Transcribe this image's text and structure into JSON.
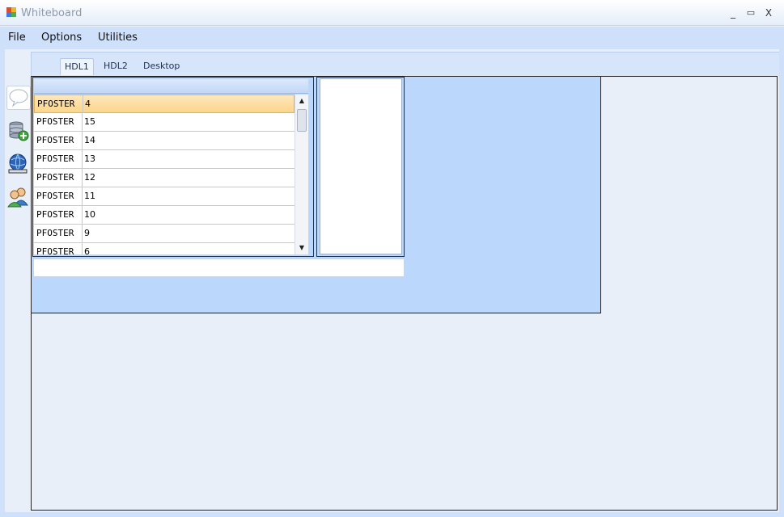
{
  "window": {
    "title": "Whiteboard",
    "minimize": "_",
    "maximize": "▭",
    "close": "X"
  },
  "menu": [
    "File",
    "Options",
    "Utilities"
  ],
  "tabs": [
    {
      "label": "HDL1",
      "active": true
    },
    {
      "label": "HDL2",
      "active": false
    },
    {
      "label": "Desktop",
      "active": false
    }
  ],
  "toolbar": [
    {
      "icon": "speech-bubble-icon",
      "active": true
    },
    {
      "icon": "database-add-icon",
      "active": false
    },
    {
      "icon": "globe-network-icon",
      "active": false
    },
    {
      "icon": "users-icon",
      "active": false
    }
  ],
  "grid": {
    "rows": [
      {
        "user": "PFOSTER",
        "value": "4",
        "selected": true
      },
      {
        "user": "PFOSTER",
        "value": "15"
      },
      {
        "user": "PFOSTER",
        "value": "14"
      },
      {
        "user": "PFOSTER",
        "value": "13"
      },
      {
        "user": "PFOSTER",
        "value": "12"
      },
      {
        "user": "PFOSTER",
        "value": "11"
      },
      {
        "user": "PFOSTER",
        "value": "10"
      },
      {
        "user": "PFOSTER",
        "value": "9"
      },
      {
        "user": "PFOSTER",
        "value": "6"
      }
    ]
  },
  "input": {
    "value": ""
  },
  "colors": {
    "panel": "#bcd7fc",
    "menubar": "#cfe0fa",
    "selected_row": "#fbd68c"
  }
}
